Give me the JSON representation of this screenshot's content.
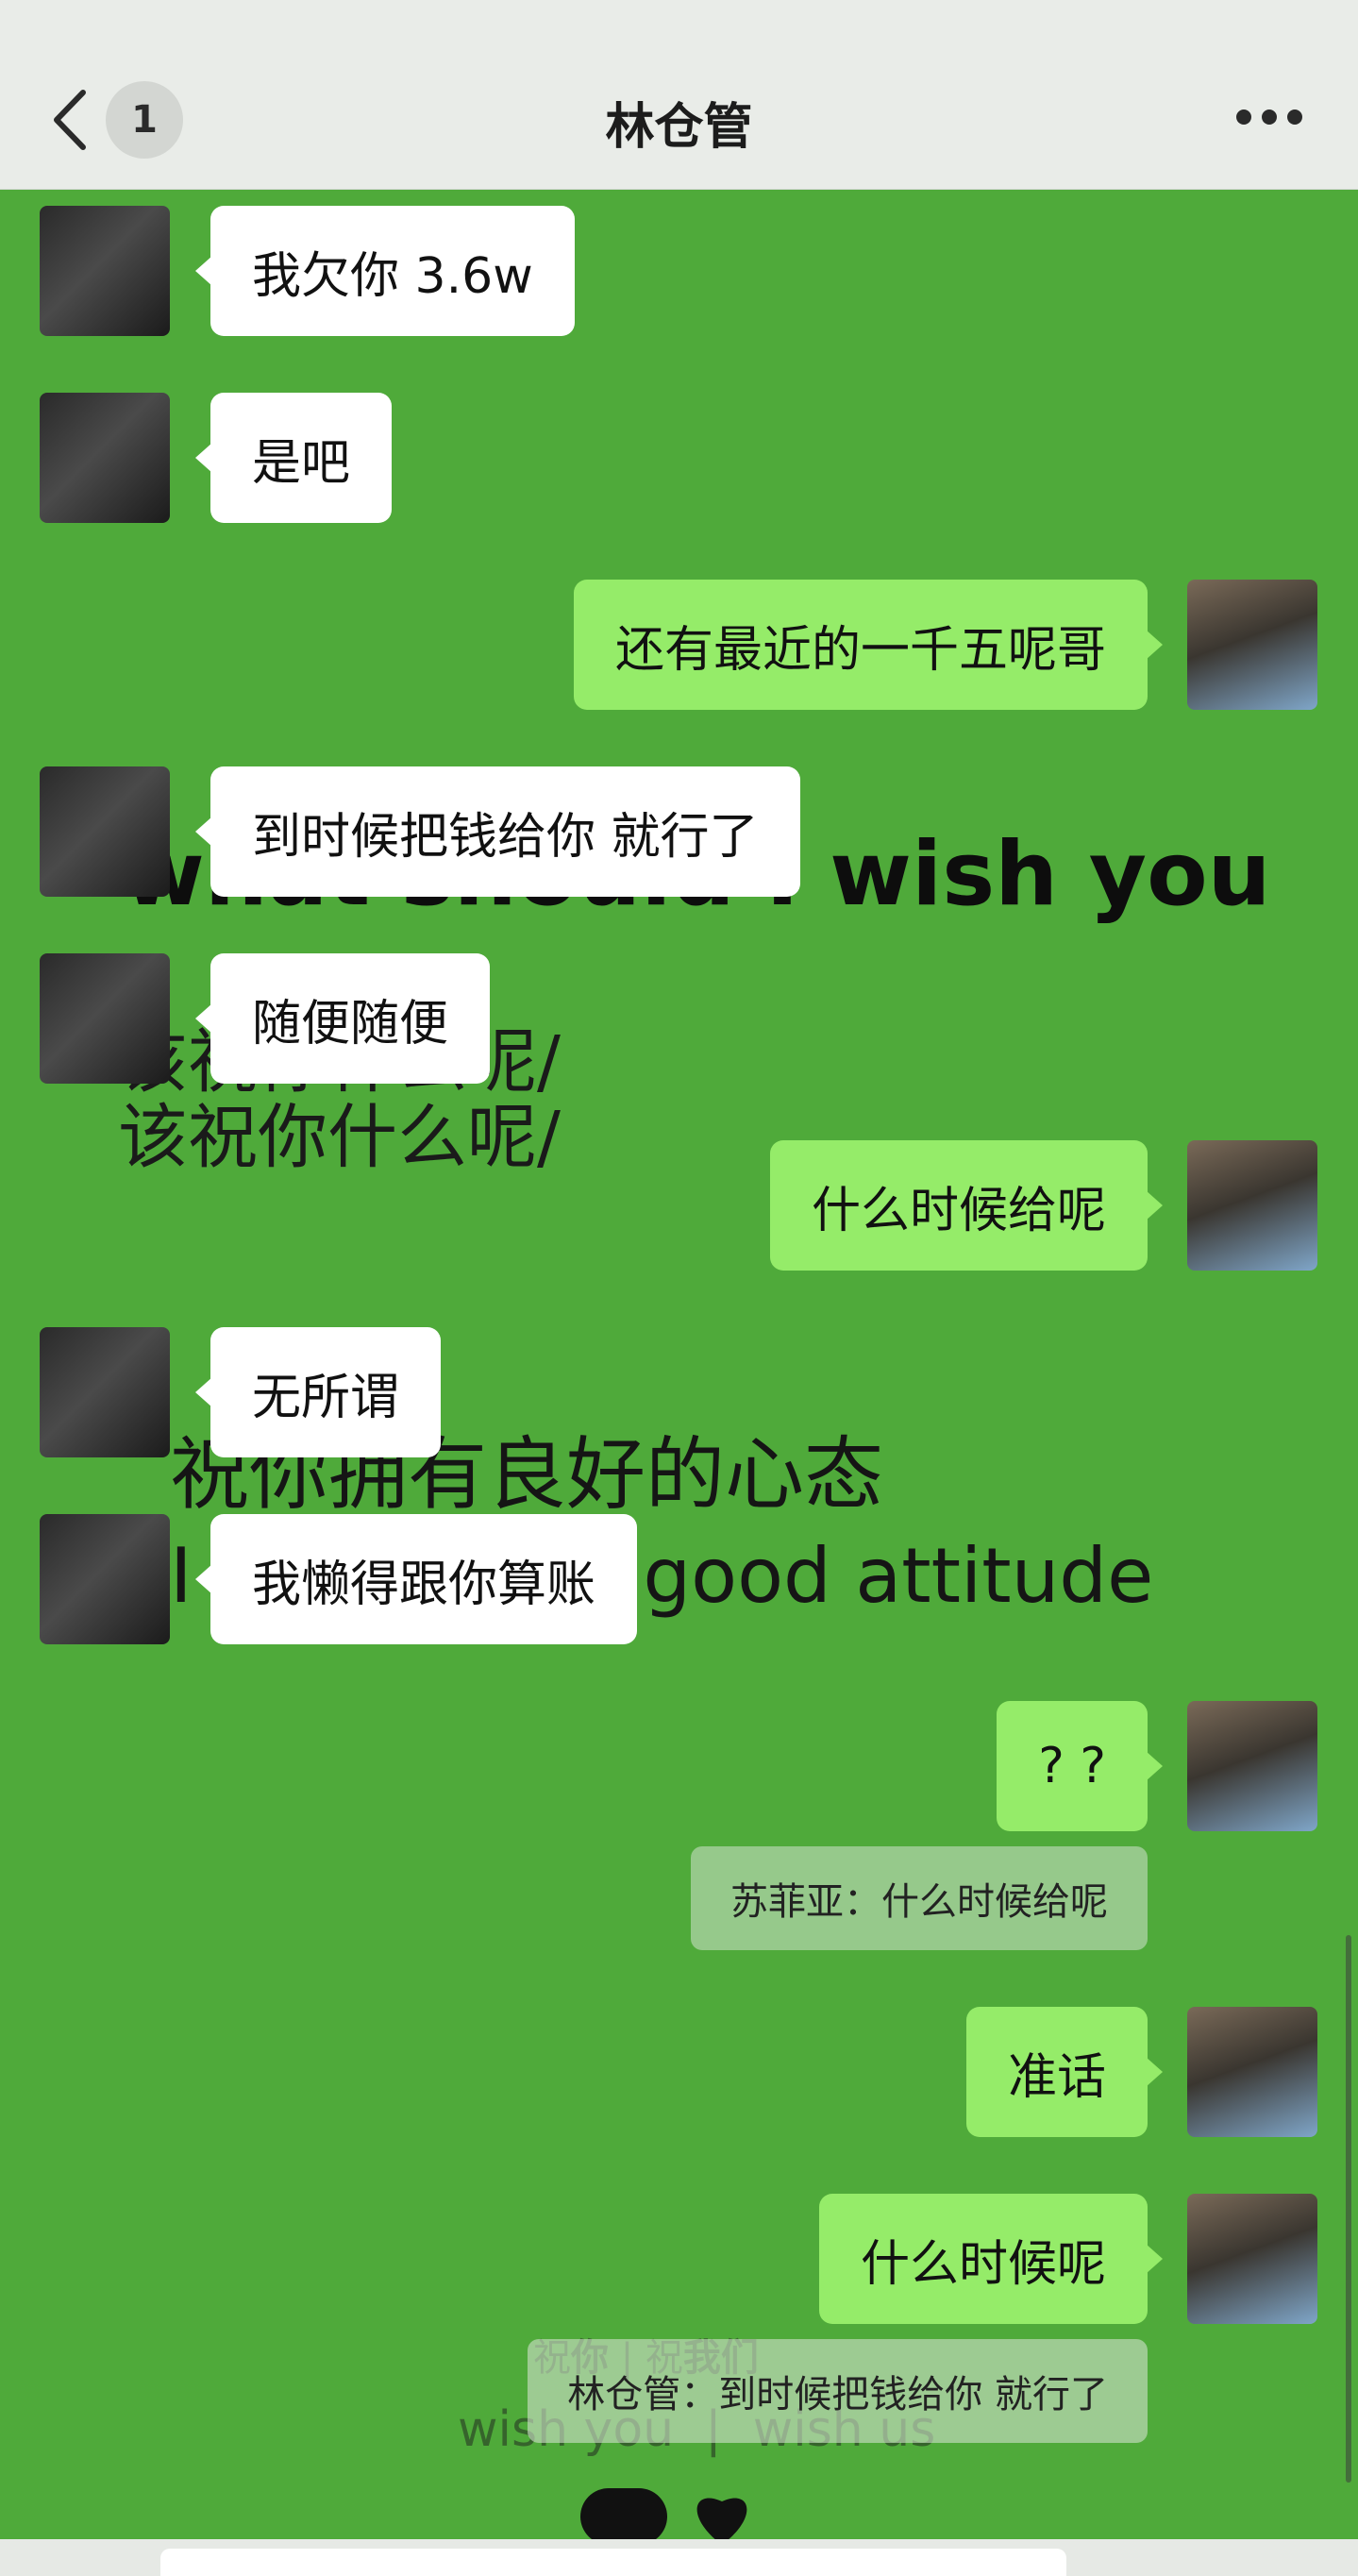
{
  "header": {
    "title": "林仓管",
    "badge_count": "1"
  },
  "background_overlay": {
    "line1": "what should I wish you",
    "line2": "该祝你什么呢/",
    "line3": "该祝你什么呢/",
    "line4": "祝你拥有良好的心态",
    "line5": "I wish you a good attitude",
    "line6_a": "祝",
    "line6_b": "你",
    "line6_sep": "|",
    "line6_c": "祝",
    "line6_d": "我们",
    "line7": "wish you  |  wish us"
  },
  "messages": [
    {
      "side": "left",
      "text": "我欠你 3.6w"
    },
    {
      "side": "left",
      "text": "是吧"
    },
    {
      "side": "right",
      "text": "还有最近的一千五呢哥"
    },
    {
      "side": "left",
      "text": "到时候把钱给你 就行了"
    },
    {
      "side": "left",
      "text": "随便随便"
    },
    {
      "side": "right",
      "text": "什么时候给呢"
    },
    {
      "side": "left",
      "text": "无所谓"
    },
    {
      "side": "left",
      "text": "我懒得跟你算账"
    },
    {
      "side": "right",
      "text": "? ?"
    },
    {
      "side": "right",
      "text": "准话"
    },
    {
      "side": "right",
      "text": "什么时候呢"
    }
  ],
  "quotes": [
    {
      "text": "苏菲亚：什么时候给呢"
    },
    {
      "text": "林仓管：到时候把钱给你 就行了"
    }
  ],
  "colors": {
    "chat_background": "#4faa3a",
    "sent_bubble": "#95ec69",
    "received_bubble": "#ffffff",
    "header": "#e9ece8"
  },
  "icons": {
    "back": "chevron-left-icon",
    "more": "more-dots-icon"
  }
}
